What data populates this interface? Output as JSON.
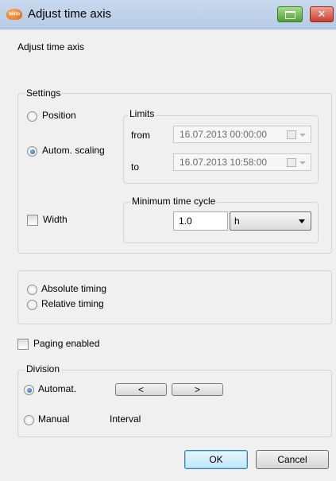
{
  "window": {
    "app_icon_text": "testo",
    "title": "Adjust time axis",
    "close_glyph": "✕"
  },
  "header": {
    "label": "Adjust time axis"
  },
  "settings": {
    "group_title": "Settings",
    "position_label": "Position",
    "autom_scaling_label": "Autom. scaling",
    "selected": "Autom. scaling",
    "limits": {
      "group_title": "Limits",
      "from_label": "from",
      "from_value": "16.07.2013 00:00:00",
      "to_label": "to",
      "to_value": "16.07.2013 10:58:00"
    },
    "width_label": "Width",
    "width_checked": false,
    "min_cycle": {
      "group_title": "Minimum time cycle",
      "value": "1.0",
      "unit": "h"
    }
  },
  "timing": {
    "absolute_label": "Absolute timing",
    "relative_label": "Relative timing"
  },
  "paging": {
    "label": "Paging enabled",
    "checked": false
  },
  "division": {
    "group_title": "Division",
    "automat_label": "Automat.",
    "prev_label": "<",
    "next_label": ">",
    "manual_label": "Manual",
    "interval_label": "Interval",
    "selected": "Automat."
  },
  "footer": {
    "ok_label": "OK",
    "cancel_label": "Cancel"
  },
  "colors": {
    "dialog_bg": "#f0f0f0",
    "titlebar": "#b7cbe6",
    "accent_blue": "#3c7fb1",
    "disabled_text": "#6d6d6d"
  }
}
